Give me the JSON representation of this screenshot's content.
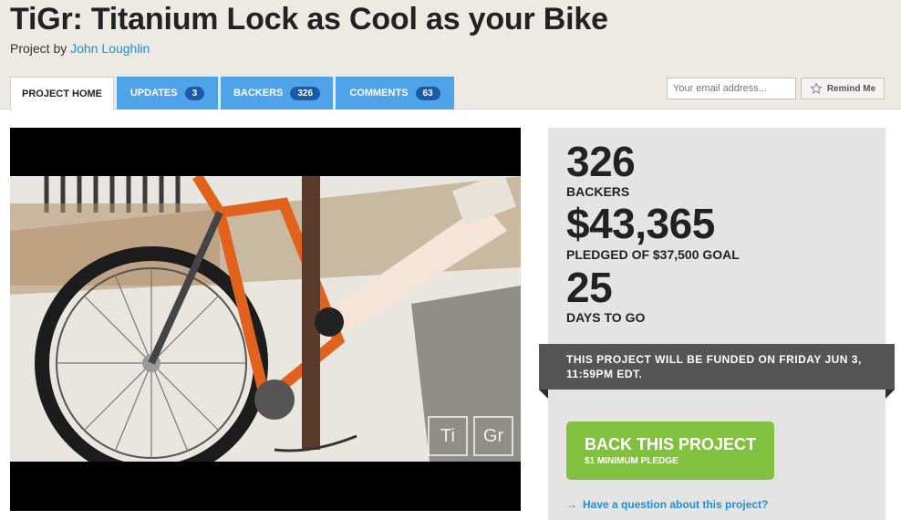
{
  "project": {
    "title": "TiGr: Titanium Lock as Cool as your Bike",
    "byline_prefix": "Project by",
    "creator": "John Loughlin"
  },
  "tabs": [
    {
      "label": "Project Home"
    },
    {
      "label": "Updates",
      "count": "3"
    },
    {
      "label": "Backers",
      "count": "326"
    },
    {
      "label": "Comments",
      "count": "63"
    }
  ],
  "remind": {
    "email_placeholder": "Your email address...",
    "button_label": "Remind Me",
    "icon": "star-outline-icon"
  },
  "video": {
    "watermark_left": "Ti",
    "watermark_right": "Gr"
  },
  "stats": {
    "backers_value": "326",
    "backers_label": "Backers",
    "pledged_value": "$43,365",
    "pledged_label": "Pledged of $37,500 goal",
    "days_value": "25",
    "days_label": "Days to go"
  },
  "funding_notice": "This project will be funded on Friday Jun 3, 11:59pm EDT.",
  "cta": {
    "label": "Back This Project",
    "sublabel": "$1 minimum pledge"
  },
  "question_link": "Have a question about this project?",
  "colors": {
    "header_bg": "#ECEAE3",
    "tab_blue": "#4FA3E8",
    "badge_blue": "#1c5aa8",
    "link_blue": "#1f8fd6",
    "cta_green": "#82C13F",
    "stats_bg": "#E4E4E4",
    "ribbon": "#555555"
  }
}
